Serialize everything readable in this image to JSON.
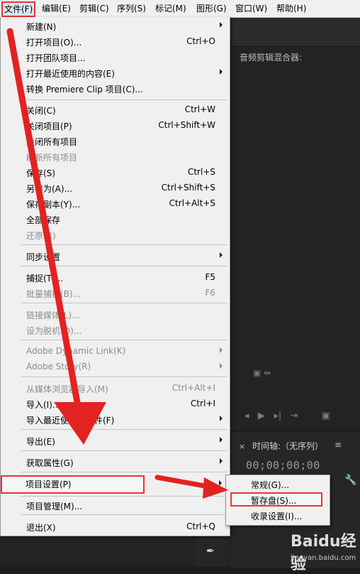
{
  "menubar": {
    "items": [
      "文件(F)",
      "编辑(E)",
      "剪辑(C)",
      "序列(S)",
      "标记(M)",
      "图形(G)",
      "窗口(W)",
      "帮助(H)"
    ]
  },
  "file_menu": {
    "items": [
      {
        "label": "新建(N)",
        "shortcut": "",
        "submenu": true,
        "disabled": false
      },
      {
        "label": "打开项目(O)...",
        "shortcut": "Ctrl+O",
        "submenu": false,
        "disabled": false
      },
      {
        "label": "打开团队项目...",
        "shortcut": "",
        "submenu": false,
        "disabled": false
      },
      {
        "label": "打开最近使用的内容(E)",
        "shortcut": "",
        "submenu": true,
        "disabled": false
      },
      {
        "label": "转换 Premiere Clip 项目(C)...",
        "shortcut": "",
        "submenu": false,
        "disabled": false
      },
      {
        "label": "关闭(C)",
        "shortcut": "Ctrl+W",
        "submenu": false,
        "disabled": false
      },
      {
        "label": "关闭项目(P)",
        "shortcut": "Ctrl+Shift+W",
        "submenu": false,
        "disabled": false
      },
      {
        "label": "关闭所有项目",
        "shortcut": "",
        "submenu": false,
        "disabled": false
      },
      {
        "label": "刷新所有项目",
        "shortcut": "",
        "submenu": false,
        "disabled": true
      },
      {
        "label": "保存(S)",
        "shortcut": "Ctrl+S",
        "submenu": false,
        "disabled": false
      },
      {
        "label": "另存为(A)...",
        "shortcut": "Ctrl+Shift+S",
        "submenu": false,
        "disabled": false
      },
      {
        "label": "保存副本(Y)...",
        "shortcut": "Ctrl+Alt+S",
        "submenu": false,
        "disabled": false
      },
      {
        "label": "全部保存",
        "shortcut": "",
        "submenu": false,
        "disabled": false
      },
      {
        "label": "还原(R)",
        "shortcut": "",
        "submenu": false,
        "disabled": true
      },
      {
        "label": "同步设置",
        "shortcut": "",
        "submenu": true,
        "disabled": false
      },
      {
        "label": "捕捉(T)...",
        "shortcut": "F5",
        "submenu": false,
        "disabled": false
      },
      {
        "label": "批量捕捉(B)...",
        "shortcut": "F6",
        "submenu": false,
        "disabled": true
      },
      {
        "label": "链接媒体(L)...",
        "shortcut": "",
        "submenu": false,
        "disabled": true
      },
      {
        "label": "设为脱机(O)...",
        "shortcut": "",
        "submenu": false,
        "disabled": true
      },
      {
        "label": "Adobe Dynamic Link(K)",
        "shortcut": "",
        "submenu": true,
        "disabled": true
      },
      {
        "label": "Adobe Story(R)",
        "shortcut": "",
        "submenu": true,
        "disabled": true
      },
      {
        "label": "从媒体浏览器导入(M)",
        "shortcut": "Ctrl+Alt+I",
        "submenu": false,
        "disabled": true
      },
      {
        "label": "导入(I)...",
        "shortcut": "Ctrl+I",
        "submenu": false,
        "disabled": false
      },
      {
        "label": "导入最近使用的文件(F)",
        "shortcut": "",
        "submenu": true,
        "disabled": false
      },
      {
        "label": "导出(E)",
        "shortcut": "",
        "submenu": true,
        "disabled": false
      },
      {
        "label": "获取属性(G)",
        "shortcut": "",
        "submenu": true,
        "disabled": false
      },
      {
        "label": "项目设置(P)",
        "shortcut": "",
        "submenu": true,
        "disabled": false
      },
      {
        "label": "项目管理(M)...",
        "shortcut": "",
        "submenu": false,
        "disabled": false
      },
      {
        "label": "退出(X)",
        "shortcut": "Ctrl+Q",
        "submenu": false,
        "disabled": false
      }
    ]
  },
  "submenu": {
    "items": [
      "常规(G)...",
      "暂存盘(S)...",
      "收录设置(I)..."
    ]
  },
  "background": {
    "mixer_label": "音频剪辑混合器:",
    "timeline_title": "时间轴:（无序列）",
    "timecode": "00;00;00;00"
  },
  "watermark": {
    "logo": "Baidu经验",
    "url": "jingyan.baidu.com"
  },
  "colors": {
    "annotation_red": "#e32222",
    "menu_bg": "#f0f0f0",
    "app_bg": "#232323"
  }
}
